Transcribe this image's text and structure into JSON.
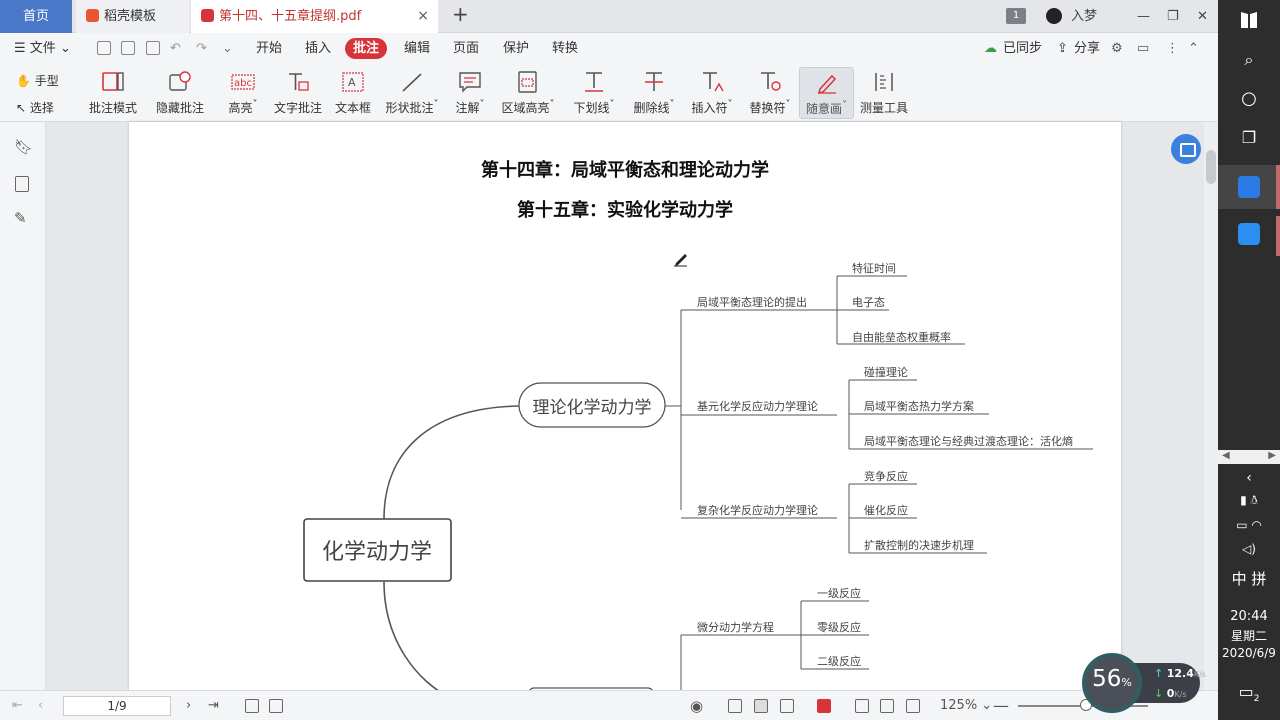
{
  "tabs": {
    "home": "首页",
    "template": "稻壳模板",
    "document": "第十四、十五章提纲.pdf",
    "close": "×",
    "new_tab": "+"
  },
  "titlebar": {
    "page_count_badge": "1",
    "user_name": "入梦",
    "minimize": "—",
    "restore": "❐",
    "close": "✕"
  },
  "menu": {
    "file": "文件",
    "items": [
      "开始",
      "插入",
      "批注",
      "编辑",
      "页面",
      "保护",
      "转换"
    ],
    "active_index": 2,
    "synced": "已同步",
    "share": "分享"
  },
  "ribbon": {
    "hand_tool": "手型",
    "select_tool": "选择",
    "buttons": [
      "批注模式",
      "隐藏批注",
      "高亮",
      "文字批注",
      "文本框",
      "形状批注",
      "注解",
      "区域高亮",
      "下划线",
      "删除线",
      "插入符",
      "替换符",
      "随意画",
      "测量工具"
    ],
    "selected": "随意画"
  },
  "document": {
    "title1": "第十四章：局域平衡态和理论动力学",
    "title2": "第十五章：实验化学动力学",
    "mindmap": {
      "root": "化学动力学",
      "branch1": "理论化学动力学",
      "b1_topics": [
        "局域平衡态理论的提出",
        "基元化学反应动力学理论",
        "复杂化学反应动力学理论"
      ],
      "b1_t1_leaves": [
        "特征时间",
        "电子态",
        "自由能垒态权重概率"
      ],
      "b1_t2_leaves": [
        "碰撞理论",
        "局域平衡态热力学方案",
        "局域平衡态理论与经典过渡态理论：活化熵"
      ],
      "b1_t3_leaves": [
        "竞争反应",
        "催化反应",
        "扩散控制的决速步机理"
      ],
      "b2_topic": "微分动力学方程",
      "b2_leaves": [
        "一级反应",
        "零级反应",
        "二级反应"
      ]
    }
  },
  "statusbar": {
    "page_indicator": "1/9",
    "zoom": "125%"
  },
  "speed_widget": {
    "percent": "56",
    "percent_unit": "%",
    "upload": "12.4",
    "upload_unit": "K/s",
    "download": "0",
    "download_unit": "K/s"
  },
  "taskbar": {
    "ime": "中",
    "ime2": "拼",
    "time": "20:44",
    "weekday": "星期二",
    "date": "2020/6/9",
    "notification_count": "2"
  },
  "colors": {
    "accent_red": "#d7343a",
    "home_tab_blue": "#4a78c9",
    "mindmap_line": "#555555"
  }
}
